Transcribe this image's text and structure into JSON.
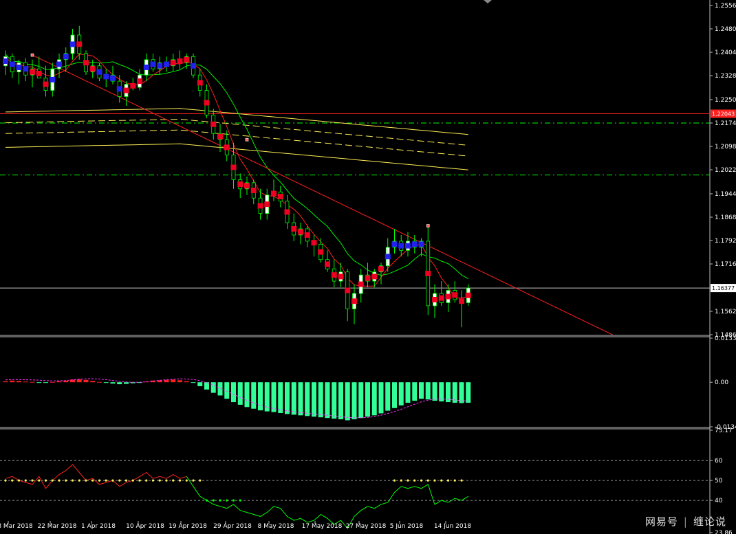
{
  "watermark": {
    "left": "网易号",
    "right": "缠论说"
  },
  "colors": {
    "background": "#000000",
    "bull_candle": "#ffffff",
    "bear_candle": "#000000",
    "candle_wick": "#00ff00",
    "heiken_up": "#2222ee",
    "heiken_down": "#ee0022",
    "ma_fast": "#ff2020",
    "ma_slow": "#00ee00",
    "ma_long": "#ffee55",
    "trendline": "#ff2020",
    "level_line": "#ff2020",
    "current_line": "#c0c0c0",
    "dash_dot_green": "#00ff00",
    "macd_hist": "#33ff99",
    "macd_hist_pos": "#ff2020",
    "macd_signal": "#ff33ff",
    "rsi_line": "#00ff00",
    "rsi_dots": "#ffee55",
    "rsi_red": "#ff2020",
    "axis_text": "#ffffff",
    "price_tag_current": "#ffffff",
    "price_tag_level": "#ff2020"
  },
  "chart_data": [
    {
      "type": "line",
      "panel": "price",
      "description": "EURUSD Daily candlestick with moving averages",
      "x_labels": [
        "8 Mar 2018",
        "22 Mar 2018",
        "1 Apr 2018",
        "10 Apr 2018",
        "19 Apr 2018",
        "29 Apr 2018",
        "8 May 2018",
        "17 May 2018",
        "27 May 2018",
        "5 Jun 2018",
        "14 Jun 2018"
      ],
      "y_ticks": [
        "1.25560",
        "1.24800",
        "1.24040",
        "1.23280",
        "1.22500",
        "1.21740",
        "1.20980",
        "1.20220",
        "1.19440",
        "1.18680",
        "1.17920",
        "1.17160",
        "1.15620",
        "1.14860"
      ],
      "ylim": [
        1.1486,
        1.2556
      ],
      "current_price_label": "1.16377",
      "level_price_label": "1.22043",
      "level_price": 1.22043,
      "current_price": 1.16377,
      "dash_levels": [
        1.2174,
        1.2005
      ],
      "candles": [
        {
          "o": 1.236,
          "h": 1.241,
          "l": 1.233,
          "c": 1.239
        },
        {
          "o": 1.239,
          "h": 1.24,
          "l": 1.232,
          "c": 1.234
        },
        {
          "o": 1.234,
          "h": 1.238,
          "l": 1.23,
          "c": 1.237
        },
        {
          "o": 1.237,
          "h": 1.2385,
          "l": 1.231,
          "c": 1.233
        },
        {
          "o": 1.233,
          "h": 1.238,
          "l": 1.229,
          "c": 1.235
        },
        {
          "o": 1.235,
          "h": 1.239,
          "l": 1.232,
          "c": 1.232
        },
        {
          "o": 1.232,
          "h": 1.236,
          "l": 1.226,
          "c": 1.228
        },
        {
          "o": 1.228,
          "h": 1.237,
          "l": 1.226,
          "c": 1.235
        },
        {
          "o": 1.235,
          "h": 1.24,
          "l": 1.232,
          "c": 1.238
        },
        {
          "o": 1.238,
          "h": 1.242,
          "l": 1.234,
          "c": 1.24
        },
        {
          "o": 1.24,
          "h": 1.248,
          "l": 1.238,
          "c": 1.246
        },
        {
          "o": 1.246,
          "h": 1.249,
          "l": 1.238,
          "c": 1.24
        },
        {
          "o": 1.24,
          "h": 1.241,
          "l": 1.233,
          "c": 1.234
        },
        {
          "o": 1.234,
          "h": 1.238,
          "l": 1.232,
          "c": 1.236
        },
        {
          "o": 1.236,
          "h": 1.237,
          "l": 1.231,
          "c": 1.232
        },
        {
          "o": 1.232,
          "h": 1.235,
          "l": 1.229,
          "c": 1.233
        },
        {
          "o": 1.233,
          "h": 1.236,
          "l": 1.23,
          "c": 1.231
        },
        {
          "o": 1.231,
          "h": 1.233,
          "l": 1.224,
          "c": 1.226
        },
        {
          "o": 1.226,
          "h": 1.231,
          "l": 1.223,
          "c": 1.23
        },
        {
          "o": 1.23,
          "h": 1.232,
          "l": 1.228,
          "c": 1.229
        },
        {
          "o": 1.229,
          "h": 1.235,
          "l": 1.228,
          "c": 1.233
        },
        {
          "o": 1.233,
          "h": 1.24,
          "l": 1.231,
          "c": 1.238
        },
        {
          "o": 1.238,
          "h": 1.24,
          "l": 1.234,
          "c": 1.235
        },
        {
          "o": 1.235,
          "h": 1.239,
          "l": 1.233,
          "c": 1.237
        },
        {
          "o": 1.237,
          "h": 1.239,
          "l": 1.234,
          "c": 1.236
        },
        {
          "o": 1.236,
          "h": 1.24,
          "l": 1.234,
          "c": 1.238
        },
        {
          "o": 1.238,
          "h": 1.241,
          "l": 1.235,
          "c": 1.237
        },
        {
          "o": 1.237,
          "h": 1.24,
          "l": 1.235,
          "c": 1.239
        },
        {
          "o": 1.239,
          "h": 1.24,
          "l": 1.232,
          "c": 1.233
        },
        {
          "o": 1.233,
          "h": 1.235,
          "l": 1.226,
          "c": 1.228
        },
        {
          "o": 1.228,
          "h": 1.23,
          "l": 1.219,
          "c": 1.22
        },
        {
          "o": 1.22,
          "h": 1.222,
          "l": 1.212,
          "c": 1.214
        },
        {
          "o": 1.214,
          "h": 1.217,
          "l": 1.208,
          "c": 1.212
        },
        {
          "o": 1.212,
          "h": 1.215,
          "l": 1.205,
          "c": 1.207
        },
        {
          "o": 1.207,
          "h": 1.211,
          "l": 1.196,
          "c": 1.199
        },
        {
          "o": 1.199,
          "h": 1.201,
          "l": 1.193,
          "c": 1.196
        },
        {
          "o": 1.196,
          "h": 1.2,
          "l": 1.194,
          "c": 1.198
        },
        {
          "o": 1.198,
          "h": 1.199,
          "l": 1.191,
          "c": 1.193
        },
        {
          "o": 1.193,
          "h": 1.196,
          "l": 1.186,
          "c": 1.188
        },
        {
          "o": 1.188,
          "h": 1.196,
          "l": 1.186,
          "c": 1.194
        },
        {
          "o": 1.194,
          "h": 1.199,
          "l": 1.192,
          "c": 1.195
        },
        {
          "o": 1.195,
          "h": 1.197,
          "l": 1.19,
          "c": 1.192
        },
        {
          "o": 1.192,
          "h": 1.194,
          "l": 1.183,
          "c": 1.185
        },
        {
          "o": 1.185,
          "h": 1.188,
          "l": 1.179,
          "c": 1.181
        },
        {
          "o": 1.181,
          "h": 1.185,
          "l": 1.178,
          "c": 1.183
        },
        {
          "o": 1.183,
          "h": 1.184,
          "l": 1.177,
          "c": 1.179
        },
        {
          "o": 1.179,
          "h": 1.181,
          "l": 1.174,
          "c": 1.178
        },
        {
          "o": 1.178,
          "h": 1.18,
          "l": 1.172,
          "c": 1.173
        },
        {
          "o": 1.173,
          "h": 1.176,
          "l": 1.169,
          "c": 1.17
        },
        {
          "o": 1.17,
          "h": 1.173,
          "l": 1.164,
          "c": 1.166
        },
        {
          "o": 1.166,
          "h": 1.172,
          "l": 1.164,
          "c": 1.169
        },
        {
          "o": 1.169,
          "h": 1.17,
          "l": 1.153,
          "c": 1.157
        },
        {
          "o": 1.157,
          "h": 1.165,
          "l": 1.152,
          "c": 1.162
        },
        {
          "o": 1.162,
          "h": 1.17,
          "l": 1.159,
          "c": 1.168
        },
        {
          "o": 1.168,
          "h": 1.172,
          "l": 1.164,
          "c": 1.166
        },
        {
          "o": 1.166,
          "h": 1.17,
          "l": 1.164,
          "c": 1.169
        },
        {
          "o": 1.169,
          "h": 1.172,
          "l": 1.165,
          "c": 1.171
        },
        {
          "o": 1.171,
          "h": 1.18,
          "l": 1.169,
          "c": 1.177
        },
        {
          "o": 1.177,
          "h": 1.183,
          "l": 1.175,
          "c": 1.179
        },
        {
          "o": 1.179,
          "h": 1.181,
          "l": 1.174,
          "c": 1.176
        },
        {
          "o": 1.176,
          "h": 1.182,
          "l": 1.174,
          "c": 1.179
        },
        {
          "o": 1.179,
          "h": 1.181,
          "l": 1.175,
          "c": 1.177
        },
        {
          "o": 1.177,
          "h": 1.18,
          "l": 1.174,
          "c": 1.179
        },
        {
          "o": 1.179,
          "h": 1.184,
          "l": 1.155,
          "c": 1.158
        },
        {
          "o": 1.158,
          "h": 1.165,
          "l": 1.154,
          "c": 1.162
        },
        {
          "o": 1.162,
          "h": 1.166,
          "l": 1.158,
          "c": 1.159
        },
        {
          "o": 1.159,
          "h": 1.165,
          "l": 1.156,
          "c": 1.163
        },
        {
          "o": 1.163,
          "h": 1.166,
          "l": 1.159,
          "c": 1.16
        },
        {
          "o": 1.16,
          "h": 1.163,
          "l": 1.151,
          "c": 1.159
        },
        {
          "o": 1.159,
          "h": 1.165,
          "l": 1.158,
          "c": 1.1638
        }
      ],
      "trendline": [
        [
          4,
          1.2395
        ],
        [
          70,
          1.1486
        ]
      ]
    },
    {
      "type": "bar",
      "panel": "macd",
      "y_ticks": [
        "0.01333",
        "0.00",
        "-0.01346"
      ],
      "ylim": [
        -0.01346,
        0.01333
      ],
      "values": [
        0.0003,
        0.0005,
        0.0004,
        0.0002,
        0.0001,
        -0.0001,
        -0.0002,
        0.0001,
        0.0003,
        0.0005,
        0.0008,
        0.0009,
        0.0007,
        0.0004,
        0.0001,
        -0.0002,
        -0.0004,
        -0.0006,
        -0.0005,
        -0.0003,
        -0.0001,
        0.0002,
        0.0005,
        0.0006,
        0.0007,
        0.0008,
        0.0006,
        0.0003,
        -0.0002,
        -0.0012,
        -0.0022,
        -0.0032,
        -0.004,
        -0.005,
        -0.006,
        -0.0068,
        -0.0075,
        -0.008,
        -0.0085,
        -0.0088,
        -0.009,
        -0.0093,
        -0.0096,
        -0.0098,
        -0.01,
        -0.0102,
        -0.0104,
        -0.0106,
        -0.0108,
        -0.011,
        -0.0112,
        -0.0115,
        -0.0112,
        -0.0108,
        -0.0104,
        -0.01,
        -0.0094,
        -0.0086,
        -0.0078,
        -0.007,
        -0.0062,
        -0.0056,
        -0.005,
        -0.0052,
        -0.0056,
        -0.0058,
        -0.006,
        -0.0062,
        -0.0063,
        -0.0062
      ]
    },
    {
      "type": "line",
      "panel": "rsi",
      "y_ticks": [
        "75.17",
        "60",
        "50",
        "40",
        "23.86"
      ],
      "ylim": [
        23.86,
        75.17
      ],
      "levels": [
        60,
        50,
        40
      ],
      "values": [
        51,
        52,
        50,
        49,
        48,
        52,
        46,
        50,
        53,
        55,
        58,
        54,
        50,
        51,
        48,
        49,
        50,
        47,
        49,
        50,
        52,
        54,
        51,
        52,
        51,
        53,
        51,
        52,
        47,
        42,
        40,
        38,
        37,
        36,
        38,
        35,
        34,
        33,
        32,
        34,
        37,
        36,
        32,
        30,
        31,
        29,
        30,
        33,
        31,
        28,
        30,
        26,
        32,
        35,
        37,
        36,
        38,
        39,
        44,
        47,
        46,
        47,
        46,
        48,
        38,
        40,
        39,
        41,
        40,
        42
      ]
    }
  ]
}
